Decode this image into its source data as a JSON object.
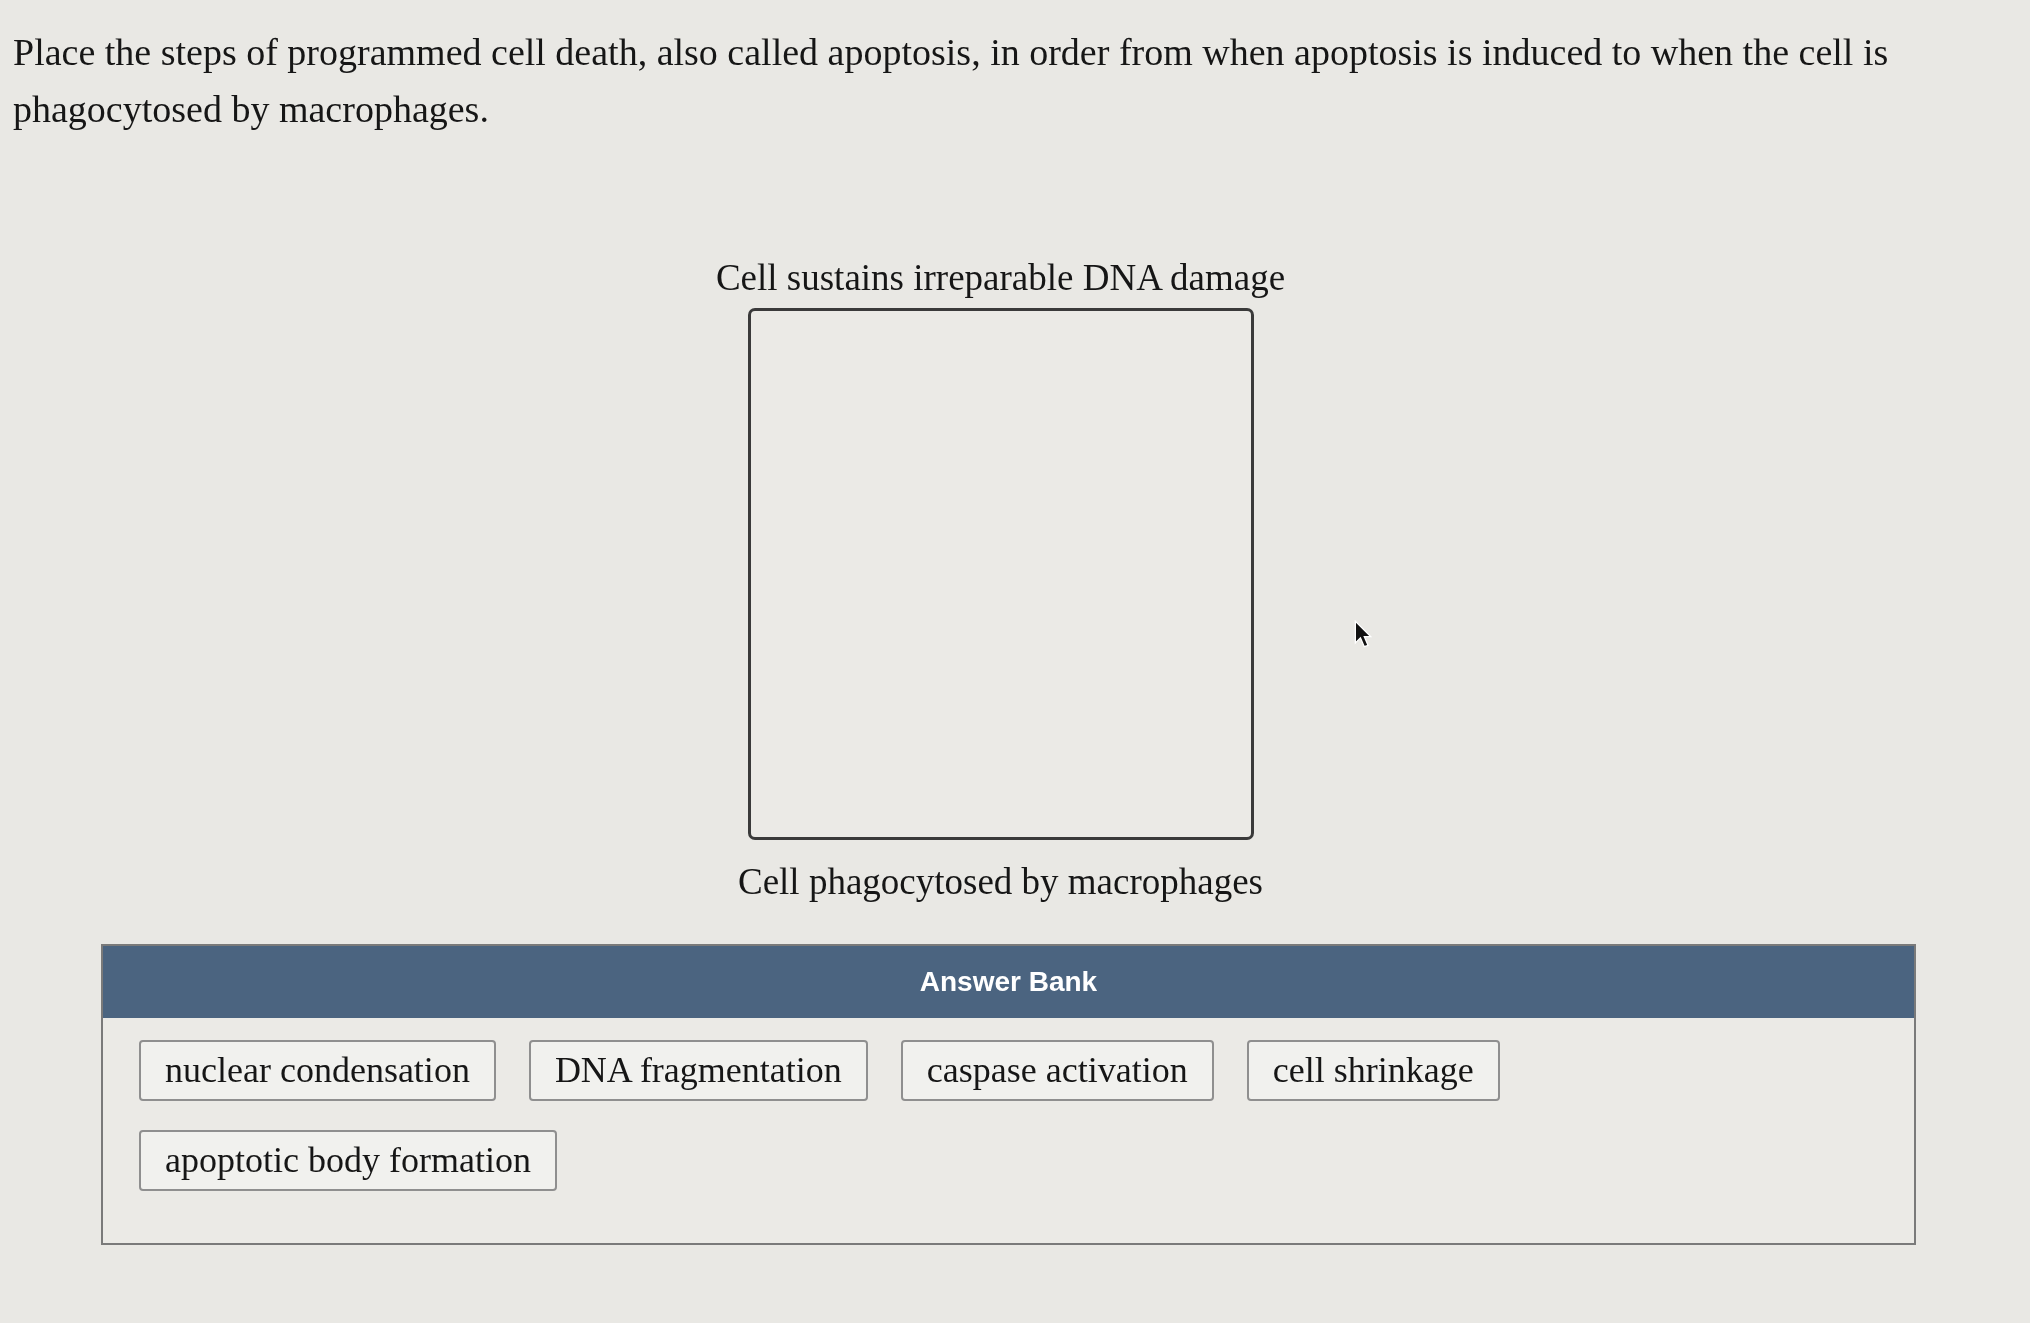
{
  "question": {
    "prompt": "Place the steps of programmed cell death, also called apoptosis, in order from when apoptosis is induced to when the cell is phagocytosed by macrophages."
  },
  "sequence": {
    "start_label": "Cell sustains irreparable DNA damage",
    "end_label": "Cell phagocytosed by macrophages"
  },
  "answer_bank": {
    "title": "Answer Bank",
    "items": [
      "nuclear condensation",
      "DNA fragmentation",
      "caspase activation",
      "cell shrinkage",
      "apoptotic body formation"
    ]
  }
}
